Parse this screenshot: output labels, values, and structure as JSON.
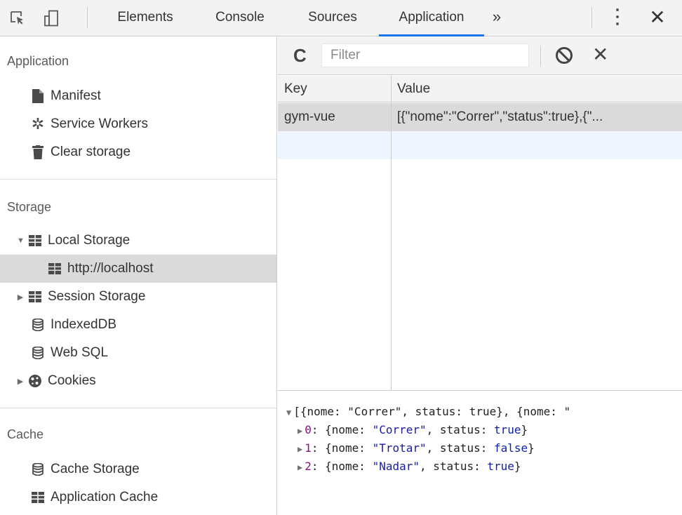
{
  "toolbar": {
    "tabs": [
      "Elements",
      "Console",
      "Sources",
      "Application"
    ],
    "active_tab": "Application",
    "more_glyph": "»",
    "close_glyph": "✕",
    "icons": [
      "inspect-icon",
      "device-toggle-icon",
      "more-tabs-icon",
      "kebab-menu-icon",
      "close-icon"
    ],
    "accent_color": "#1a73e8"
  },
  "sidebar": {
    "application": {
      "title": "Application",
      "items": [
        {
          "label": "Manifest",
          "icon": "document-icon"
        },
        {
          "label": "Service Workers",
          "icon": "gear-icon"
        },
        {
          "label": "Clear storage",
          "icon": "trash-icon"
        }
      ]
    },
    "storage": {
      "title": "Storage",
      "items": [
        {
          "label": "Local Storage",
          "icon": "table-icon",
          "arrow": "▼"
        },
        {
          "label": "http://localhost",
          "icon": "table-icon",
          "selected": true
        },
        {
          "label": "Session Storage",
          "icon": "table-icon",
          "arrow": "▶"
        },
        {
          "label": "IndexedDB",
          "icon": "database-icon"
        },
        {
          "label": "Web SQL",
          "icon": "database-icon"
        },
        {
          "label": "Cookies",
          "icon": "cookie-icon",
          "arrow": "▶"
        }
      ]
    },
    "cache": {
      "title": "Cache",
      "items": [
        {
          "label": "Cache Storage",
          "icon": "database-icon"
        },
        {
          "label": "Application Cache",
          "icon": "table-icon"
        }
      ]
    }
  },
  "filterbar": {
    "refresh_glyph": "C",
    "filter_placeholder": "Filter",
    "clear_glyph": "✕"
  },
  "grid": {
    "columns": [
      "Key",
      "Value"
    ],
    "rows": [
      {
        "key": "gym-vue",
        "value": "[{\"nome\":\"Correr\",\"status\":true},{\"..."
      }
    ]
  },
  "preview": {
    "summary": "[{nome: \"Correr\", status: true}, {nome: \"",
    "items": [
      {
        "index": "0",
        "nome": "\"Correr\"",
        "status": "true"
      },
      {
        "index": "1",
        "nome": "\"Trotar\"",
        "status": "false"
      },
      {
        "index": "2",
        "nome": "\"Nadar\"",
        "status": "true"
      }
    ]
  }
}
